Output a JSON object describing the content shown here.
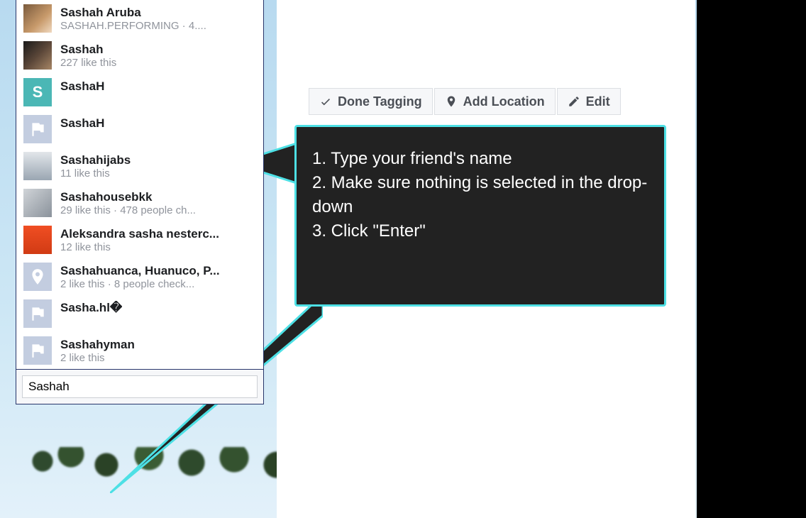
{
  "toolbar": {
    "done_tagging": "Done Tagging",
    "add_location": "Add Location",
    "edit": "Edit"
  },
  "dropdown": {
    "items": [
      {
        "name": "Sashah Aruba",
        "sub": "SASHAH.PERFORMING · 4....",
        "avatar": "av1"
      },
      {
        "name": "Sashah",
        "sub": "227 like this",
        "avatar": "av2"
      },
      {
        "name": "SashaH",
        "sub": "",
        "avatar": "teal",
        "letter": "S"
      },
      {
        "name": "SashaH",
        "sub": "",
        "avatar": "flag"
      },
      {
        "name": "Sashahijabs",
        "sub": "11 like this",
        "avatar": "av5"
      },
      {
        "name": "Sashahousebkk",
        "sub": "29 like this · 478 people ch...",
        "avatar": "av6"
      },
      {
        "name": "Aleksandra sasha nesterc...",
        "sub": "12 like this",
        "avatar": "av7"
      },
      {
        "name": "Sashahuanca, Huanuco, P...",
        "sub": "2 like this · 8 people check...",
        "avatar": "pin"
      },
      {
        "name": "Sasha.hl�",
        "sub": "",
        "avatar": "flag"
      },
      {
        "name": "Sashahyman",
        "sub": "2 like this",
        "avatar": "flag"
      }
    ],
    "input_value": "Sashah "
  },
  "callout": {
    "line1": "1. Type your friend's name",
    "line2": "2. Make sure nothing is selected in the drop-down",
    "line3": "3. Click \"Enter\""
  }
}
